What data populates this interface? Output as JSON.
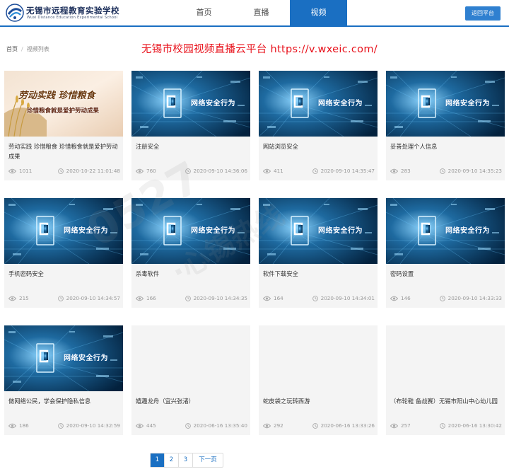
{
  "header": {
    "school_name": "无锡市远程教育实验学校",
    "school_name_en": "Wuxi Distance Education Experimental School",
    "nav": [
      {
        "label": "首页",
        "active": false
      },
      {
        "label": "直播",
        "active": false
      },
      {
        "label": "视频",
        "active": true
      }
    ],
    "return_label": "返回平台",
    "accent_color": "#1a6fc2"
  },
  "breadcrumb": {
    "home": "首页",
    "separator": "/",
    "current": "视频列表"
  },
  "promo_text": "无锡市校园视频直播云平台  https://v.wxeic.com/",
  "thumbnail_caption": "网络安全行为",
  "labor_thumbnail": {
    "line1": "劳动实践 珍惜粮食",
    "line2": "珍惜粮食就是爱护劳动成果"
  },
  "watermark": {
    "main": "0527",
    "sub": "·心锡热线"
  },
  "videos": [
    {
      "title": "劳动实践 珍惜粮食 珍惜粮食就是爱护劳动成果",
      "views": "1011",
      "date": "2020-10-22 11:01:48",
      "thumb": "labor"
    },
    {
      "title": "注册安全",
      "views": "760",
      "date": "2020-09-10 14:36:06",
      "thumb": "security"
    },
    {
      "title": "网站浏览安全",
      "views": "411",
      "date": "2020-09-10 14:35:47",
      "thumb": "security"
    },
    {
      "title": "妥善处理个人信息",
      "views": "283",
      "date": "2020-09-10 14:35:23",
      "thumb": "security"
    },
    {
      "title": "手机密码安全",
      "views": "215",
      "date": "2020-09-10 14:34:57",
      "thumb": "security"
    },
    {
      "title": "杀毒软件",
      "views": "166",
      "date": "2020-09-10 14:34:35",
      "thumb": "security"
    },
    {
      "title": "软件下载安全",
      "views": "164",
      "date": "2020-09-10 14:34:01",
      "thumb": "security"
    },
    {
      "title": "密码设置",
      "views": "146",
      "date": "2020-09-10 14:33:33",
      "thumb": "security"
    },
    {
      "title": "做网络公民，学会保护隐私信息",
      "views": "186",
      "date": "2020-09-10 14:32:59",
      "thumb": "security"
    },
    {
      "title": "嬉趣龙舟（宜兴张渚）",
      "views": "445",
      "date": "2020-06-16 13:35:40",
      "thumb": "none"
    },
    {
      "title": "蛇皮袋之玩转西游",
      "views": "292",
      "date": "2020-06-16 13:33:26",
      "thumb": "none"
    },
    {
      "title": "（布轮鞋 备战赛）无锡市阳山中心幼儿园",
      "views": "257",
      "date": "2020-06-16 13:30:42",
      "thumb": "none"
    }
  ],
  "pagination": {
    "pages": [
      "1",
      "2",
      "3"
    ],
    "current": "1",
    "next_label": "下一页"
  }
}
